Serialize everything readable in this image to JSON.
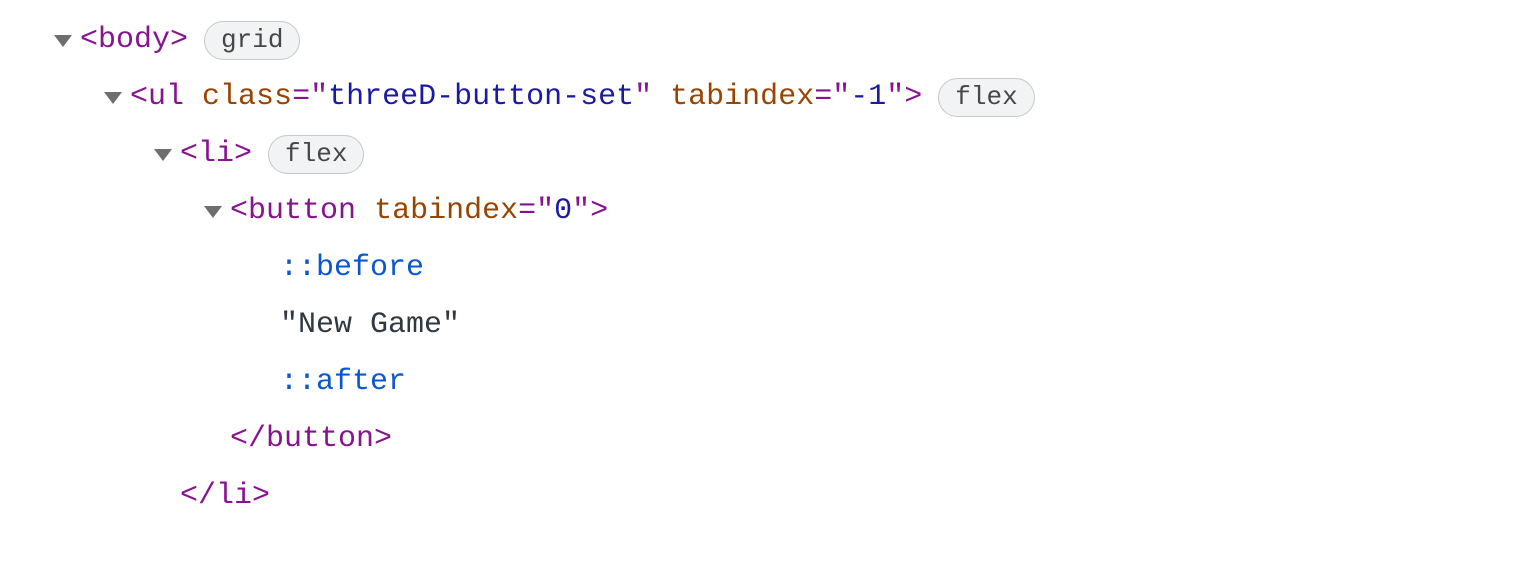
{
  "tree": {
    "body": {
      "tagOpen": "<body>",
      "badge": "grid"
    },
    "ul": {
      "lt": "<",
      "tagName": "ul",
      "classAttr": "class",
      "eq1": "=\"",
      "classVal": "threeD-button-set",
      "q1": "\"",
      "tabAttr": "tabindex",
      "eq2": "=\"",
      "tabVal": "-1",
      "q2": "\"",
      "gt": ">",
      "badge": "flex"
    },
    "li": {
      "tagOpen": "<li>",
      "badge": "flex",
      "tagClose": "</li>"
    },
    "button": {
      "lt": "<",
      "tagName": "button",
      "tabAttr": "tabindex",
      "eq": "=\"",
      "tabVal": "0",
      "q": "\"",
      "gt": ">",
      "tagClose": "</button>"
    },
    "pseudoBefore": "::before",
    "textNode": "\"New Game\"",
    "pseudoAfter": "::after"
  }
}
